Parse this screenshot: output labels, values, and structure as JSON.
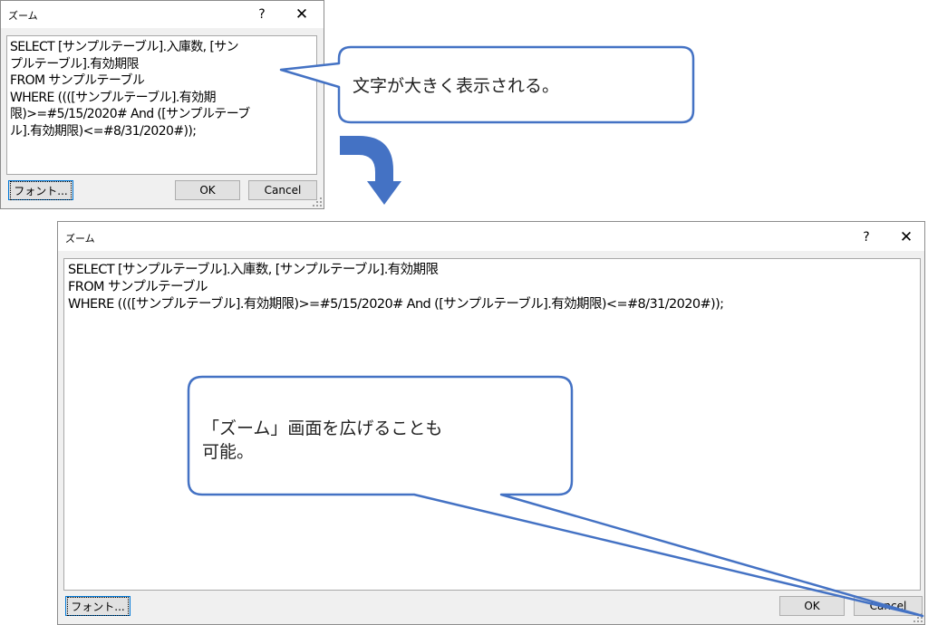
{
  "small_dialog": {
    "title": "ズーム",
    "help": "?",
    "close": "✕",
    "lines": [
      "SELECT [サンプルテーブル].入庫数, [サン",
      "プルテーブル].有効期限",
      "FROM サンプルテーブル",
      "WHERE ((([サンプルテーブル].有効期",
      "限)>=#5/15/2020# And ([サンプルテーブ",
      "ル].有効期限)<=#8/31/2020#));"
    ],
    "font_button": "フォント...",
    "ok_button": "OK",
    "cancel_button": "Cancel"
  },
  "large_dialog": {
    "title": "ズーム",
    "help": "?",
    "close": "✕",
    "lines": [
      "SELECT [サンプルテーブル].入庫数, [サンプルテーブル].有効期限",
      "FROM サンプルテーブル",
      "WHERE ((([サンプルテーブル].有効期限)>=#5/15/2020# And ([サンプルテーブル].有効期限)<=#8/31/2020#));"
    ],
    "font_button": "フォント...",
    "ok_button": "OK",
    "cancel_button": "Cancel"
  },
  "callouts": {
    "top": "文字が大きく表示される。",
    "bottom_line1": "「ズーム」画面を広げることも",
    "bottom_line2": "可能。"
  },
  "colors": {
    "callout_border": "#4472c4",
    "arrow": "#4472c4",
    "focus": "#0078d7"
  }
}
